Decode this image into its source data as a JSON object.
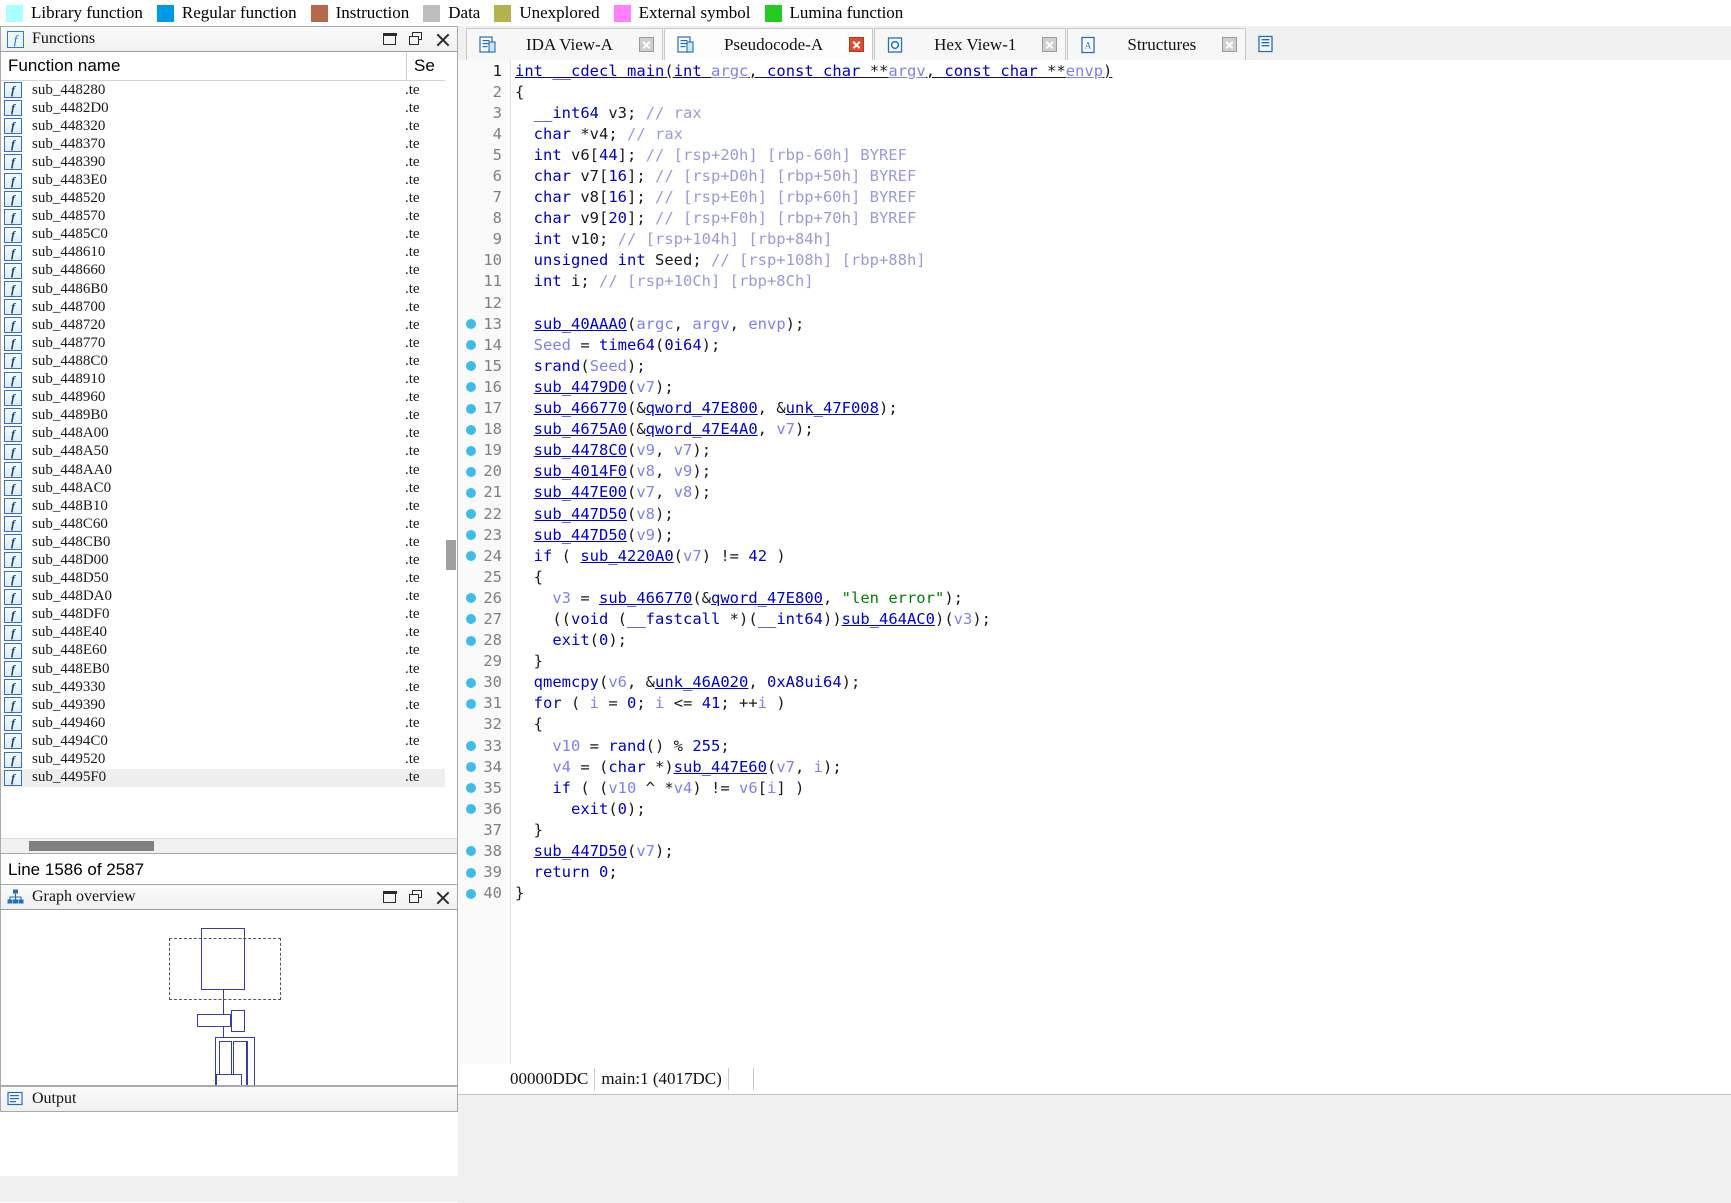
{
  "legend": {
    "items": [
      {
        "label": "Library function",
        "color": "#aaffff"
      },
      {
        "label": "Regular function",
        "color": "#0099e6"
      },
      {
        "label": "Instruction",
        "color": "#b5694a"
      },
      {
        "label": "Data",
        "color": "#bdbdbd"
      },
      {
        "label": "Unexplored",
        "color": "#b3b34d"
      },
      {
        "label": "External symbol",
        "color": "#ff80ff"
      },
      {
        "label": "Lumina function",
        "color": "#22cc22"
      }
    ]
  },
  "functions_panel": {
    "title": "Functions",
    "icon": "function-icon",
    "columns": [
      "Function name",
      "Se"
    ],
    "rows": [
      {
        "name": "sub_448280",
        "segment": ".te"
      },
      {
        "name": "sub_4482D0",
        "segment": ".te"
      },
      {
        "name": "sub_448320",
        "segment": ".te"
      },
      {
        "name": "sub_448370",
        "segment": ".te"
      },
      {
        "name": "sub_448390",
        "segment": ".te"
      },
      {
        "name": "sub_4483E0",
        "segment": ".te"
      },
      {
        "name": "sub_448520",
        "segment": ".te"
      },
      {
        "name": "sub_448570",
        "segment": ".te"
      },
      {
        "name": "sub_4485C0",
        "segment": ".te"
      },
      {
        "name": "sub_448610",
        "segment": ".te"
      },
      {
        "name": "sub_448660",
        "segment": ".te"
      },
      {
        "name": "sub_4486B0",
        "segment": ".te"
      },
      {
        "name": "sub_448700",
        "segment": ".te"
      },
      {
        "name": "sub_448720",
        "segment": ".te"
      },
      {
        "name": "sub_448770",
        "segment": ".te"
      },
      {
        "name": "sub_4488C0",
        "segment": ".te"
      },
      {
        "name": "sub_448910",
        "segment": ".te"
      },
      {
        "name": "sub_448960",
        "segment": ".te"
      },
      {
        "name": "sub_4489B0",
        "segment": ".te"
      },
      {
        "name": "sub_448A00",
        "segment": ".te"
      },
      {
        "name": "sub_448A50",
        "segment": ".te"
      },
      {
        "name": "sub_448AA0",
        "segment": ".te"
      },
      {
        "name": "sub_448AC0",
        "segment": ".te"
      },
      {
        "name": "sub_448B10",
        "segment": ".te"
      },
      {
        "name": "sub_448C60",
        "segment": ".te"
      },
      {
        "name": "sub_448CB0",
        "segment": ".te"
      },
      {
        "name": "sub_448D00",
        "segment": ".te"
      },
      {
        "name": "sub_448D50",
        "segment": ".te"
      },
      {
        "name": "sub_448DA0",
        "segment": ".te"
      },
      {
        "name": "sub_448DF0",
        "segment": ".te"
      },
      {
        "name": "sub_448E40",
        "segment": ".te"
      },
      {
        "name": "sub_448E60",
        "segment": ".te"
      },
      {
        "name": "sub_448EB0",
        "segment": ".te"
      },
      {
        "name": "sub_449330",
        "segment": ".te"
      },
      {
        "name": "sub_449390",
        "segment": ".te"
      },
      {
        "name": "sub_449460",
        "segment": ".te"
      },
      {
        "name": "sub_4494C0",
        "segment": ".te"
      },
      {
        "name": "sub_449520",
        "segment": ".te"
      },
      {
        "name": "sub_4495F0",
        "segment": ".te",
        "selected": true
      }
    ],
    "status": "Line 1586 of 2587"
  },
  "graph_overview": {
    "title": "Graph overview",
    "icon": "graph-icon"
  },
  "output_panel": {
    "title": "Output",
    "icon": "output-icon"
  },
  "tabs": [
    {
      "label": "IDA View-A",
      "icon": "document-icon",
      "active": false,
      "close_style": "grey"
    },
    {
      "label": "Pseudocode-A",
      "icon": "document-icon",
      "active": true,
      "close_style": "red"
    },
    {
      "label": "Hex View-1",
      "icon": "hex-icon",
      "active": false,
      "close_style": "grey"
    },
    {
      "label": "Structures",
      "icon": "structures-icon",
      "active": false,
      "close_style": "grey"
    }
  ],
  "pseudocode": {
    "status_address": "00000DDC",
    "status_location": "main:1  (4017DC)",
    "lines": [
      {
        "n": 1,
        "bp": false,
        "html": "<span class='c-kw c-underline'>int</span><span class='c-plain c-underline'> </span><span class='c-kw c-underline'>__cdecl</span><span class='c-plain c-underline'> </span><span class='c-lib c-underline'>main</span><span class='c-plain c-underline'>(</span><span class='c-kw c-underline'>int</span><span class='c-plain c-underline'> </span><span class='c-var c-underline'>argc</span><span class='c-plain c-underline'>, </span><span class='c-kw c-underline'>const</span><span class='c-plain c-underline'> </span><span class='c-kw c-underline'>char</span><span class='c-plain c-underline'> **</span><span class='c-var c-underline'>argv</span><span class='c-plain c-underline'>, </span><span class='c-kw c-underline'>const</span><span class='c-plain c-underline'> </span><span class='c-kw c-underline'>char</span><span class='c-plain c-underline'> **</span><span class='c-var c-underline'>envp</span><span class='c-plain c-underline'>)</span>"
      },
      {
        "n": 2,
        "bp": false,
        "html": "<span class='c-plain'>{</span>"
      },
      {
        "n": 3,
        "bp": false,
        "html": "<span class='c-plain'>  </span><span class='c-kw'>__int64</span><span class='c-plain'> v3; </span><span class='c-cmt'>// rax</span>"
      },
      {
        "n": 4,
        "bp": false,
        "html": "<span class='c-plain'>  </span><span class='c-kw'>char</span><span class='c-plain'> *v4; </span><span class='c-cmt'>// rax</span>"
      },
      {
        "n": 5,
        "bp": false,
        "html": "<span class='c-plain'>  </span><span class='c-kw'>int</span><span class='c-plain'> v6[</span><span class='c-kw'>44</span><span class='c-plain'>]; </span><span class='c-cmt'>// [rsp+20h] [rbp-60h] BYREF</span>"
      },
      {
        "n": 6,
        "bp": false,
        "html": "<span class='c-plain'>  </span><span class='c-kw'>char</span><span class='c-plain'> v7[</span><span class='c-kw'>16</span><span class='c-plain'>]; </span><span class='c-cmt'>// [rsp+D0h] [rbp+50h] BYREF</span>"
      },
      {
        "n": 7,
        "bp": false,
        "html": "<span class='c-plain'>  </span><span class='c-kw'>char</span><span class='c-plain'> v8[</span><span class='c-kw'>16</span><span class='c-plain'>]; </span><span class='c-cmt'>// [rsp+E0h] [rbp+60h] BYREF</span>"
      },
      {
        "n": 8,
        "bp": false,
        "html": "<span class='c-plain'>  </span><span class='c-kw'>char</span><span class='c-plain'> v9[</span><span class='c-kw'>20</span><span class='c-plain'>]; </span><span class='c-cmt'>// [rsp+F0h] [rbp+70h] BYREF</span>"
      },
      {
        "n": 9,
        "bp": false,
        "html": "<span class='c-plain'>  </span><span class='c-kw'>int</span><span class='c-plain'> v10; </span><span class='c-cmt'>// [rsp+104h] [rbp+84h]</span>"
      },
      {
        "n": 10,
        "bp": false,
        "html": "<span class='c-plain'>  </span><span class='c-kw'>unsigned int</span><span class='c-plain'> Seed; </span><span class='c-cmt'>// [rsp+108h] [rbp+88h]</span>"
      },
      {
        "n": 11,
        "bp": false,
        "html": "<span class='c-plain'>  </span><span class='c-kw'>int</span><span class='c-plain'> i; </span><span class='c-cmt'>// [rsp+10Ch] [rbp+8Ch]</span>"
      },
      {
        "n": 12,
        "bp": false,
        "html": ""
      },
      {
        "n": 13,
        "bp": true,
        "html": "<span class='c-plain'>  </span><span class='c-fn'>sub_40AAA0</span><span class='c-plain'>(</span><span class='c-var'>argc</span><span class='c-plain'>, </span><span class='c-var'>argv</span><span class='c-plain'>, </span><span class='c-var'>envp</span><span class='c-plain'>);</span>"
      },
      {
        "n": 14,
        "bp": true,
        "html": "<span class='c-plain'>  </span><span class='c-var'>Seed</span><span class='c-plain'> = </span><span class='c-lib'>time64</span><span class='c-plain'>(</span><span class='c-kw'>0i64</span><span class='c-plain'>);</span>"
      },
      {
        "n": 15,
        "bp": true,
        "html": "<span class='c-plain'>  </span><span class='c-lib'>srand</span><span class='c-plain'>(</span><span class='c-var'>Seed</span><span class='c-plain'>);</span>"
      },
      {
        "n": 16,
        "bp": true,
        "html": "<span class='c-plain'>  </span><span class='c-fn'>sub_4479D0</span><span class='c-plain'>(</span><span class='c-var'>v7</span><span class='c-plain'>);</span>"
      },
      {
        "n": 17,
        "bp": true,
        "html": "<span class='c-plain'>  </span><span class='c-fn'>sub_466770</span><span class='c-plain'>(&amp;</span><span class='c-fn'>qword_47E800</span><span class='c-plain'>, &amp;</span><span class='c-fn'>unk_47F008</span><span class='c-plain'>);</span>"
      },
      {
        "n": 18,
        "bp": true,
        "html": "<span class='c-plain'>  </span><span class='c-fn'>sub_4675A0</span><span class='c-plain'>(&amp;</span><span class='c-fn'>qword_47E4A0</span><span class='c-plain'>, </span><span class='c-var'>v7</span><span class='c-plain'>);</span>"
      },
      {
        "n": 19,
        "bp": true,
        "html": "<span class='c-plain'>  </span><span class='c-fn'>sub_4478C0</span><span class='c-plain'>(</span><span class='c-var'>v9</span><span class='c-plain'>, </span><span class='c-var'>v7</span><span class='c-plain'>);</span>"
      },
      {
        "n": 20,
        "bp": true,
        "html": "<span class='c-plain'>  </span><span class='c-fn'>sub_4014F0</span><span class='c-plain'>(</span><span class='c-var'>v8</span><span class='c-plain'>, </span><span class='c-var'>v9</span><span class='c-plain'>);</span>"
      },
      {
        "n": 21,
        "bp": true,
        "html": "<span class='c-plain'>  </span><span class='c-fn'>sub_447E00</span><span class='c-plain'>(</span><span class='c-var'>v7</span><span class='c-plain'>, </span><span class='c-var'>v8</span><span class='c-plain'>);</span>"
      },
      {
        "n": 22,
        "bp": true,
        "html": "<span class='c-plain'>  </span><span class='c-fn'>sub_447D50</span><span class='c-plain'>(</span><span class='c-var'>v8</span><span class='c-plain'>);</span>"
      },
      {
        "n": 23,
        "bp": true,
        "html": "<span class='c-plain'>  </span><span class='c-fn'>sub_447D50</span><span class='c-plain'>(</span><span class='c-var'>v9</span><span class='c-plain'>);</span>"
      },
      {
        "n": 24,
        "bp": true,
        "html": "<span class='c-plain'>  </span><span class='c-kw'>if</span><span class='c-plain'> ( </span><span class='c-fn'>sub_4220A0</span><span class='c-plain'>(</span><span class='c-var'>v7</span><span class='c-plain'>) != </span><span class='c-kw'>42</span><span class='c-plain'> )</span>"
      },
      {
        "n": 25,
        "bp": false,
        "html": "<span class='c-plain'>  {</span>"
      },
      {
        "n": 26,
        "bp": true,
        "html": "<span class='c-plain'>    </span><span class='c-var'>v3</span><span class='c-plain'> = </span><span class='c-fn'>sub_466770</span><span class='c-plain'>(&amp;</span><span class='c-fn'>qword_47E800</span><span class='c-plain'>, </span><span class='c-str'>\"len error\"</span><span class='c-plain'>);</span>"
      },
      {
        "n": 27,
        "bp": true,
        "html": "<span class='c-plain'>    ((</span><span class='c-kw'>void</span><span class='c-plain'> (</span><span class='c-kw'>__fastcall</span><span class='c-plain'> *)(</span><span class='c-kw'>__int64</span><span class='c-plain'>))</span><span class='c-fn'>sub_464AC0</span><span class='c-plain'>)(</span><span class='c-var'>v3</span><span class='c-plain'>);</span>"
      },
      {
        "n": 28,
        "bp": true,
        "html": "<span class='c-plain'>    </span><span class='c-lib'>exit</span><span class='c-plain'>(</span><span class='c-kw'>0</span><span class='c-plain'>);</span>"
      },
      {
        "n": 29,
        "bp": false,
        "html": "<span class='c-plain'>  }</span>"
      },
      {
        "n": 30,
        "bp": true,
        "html": "<span class='c-plain'>  </span><span class='c-lib'>qmemcpy</span><span class='c-plain'>(</span><span class='c-var'>v6</span><span class='c-plain'>, &amp;</span><span class='c-fn'>unk_46A020</span><span class='c-plain'>, </span><span class='c-kw'>0xA8ui64</span><span class='c-plain'>);</span>"
      },
      {
        "n": 31,
        "bp": true,
        "html": "<span class='c-plain'>  </span><span class='c-kw'>for</span><span class='c-plain'> ( </span><span class='c-var'>i</span><span class='c-plain'> = </span><span class='c-kw'>0</span><span class='c-plain'>; </span><span class='c-var'>i</span><span class='c-plain'> &lt;= </span><span class='c-kw'>41</span><span class='c-plain'>; ++</span><span class='c-var'>i</span><span class='c-plain'> )</span>"
      },
      {
        "n": 32,
        "bp": false,
        "html": "<span class='c-plain'>  {</span>"
      },
      {
        "n": 33,
        "bp": true,
        "html": "<span class='c-plain'>    </span><span class='c-var'>v10</span><span class='c-plain'> = </span><span class='c-lib'>rand</span><span class='c-plain'>() % </span><span class='c-kw'>255</span><span class='c-plain'>;</span>"
      },
      {
        "n": 34,
        "bp": true,
        "html": "<span class='c-plain'>    </span><span class='c-var'>v4</span><span class='c-plain'> = (</span><span class='c-kw'>char</span><span class='c-plain'> *)</span><span class='c-fn'>sub_447E60</span><span class='c-plain'>(</span><span class='c-var'>v7</span><span class='c-plain'>, </span><span class='c-var'>i</span><span class='c-plain'>);</span>"
      },
      {
        "n": 35,
        "bp": true,
        "html": "<span class='c-plain'>    </span><span class='c-kw'>if</span><span class='c-plain'> ( (</span><span class='c-var'>v10</span><span class='c-plain'> ^ *</span><span class='c-var'>v4</span><span class='c-plain'>) != </span><span class='c-var'>v6</span><span class='c-plain'>[</span><span class='c-var'>i</span><span class='c-plain'>] )</span>"
      },
      {
        "n": 36,
        "bp": true,
        "html": "<span class='c-plain'>      </span><span class='c-lib'>exit</span><span class='c-plain'>(</span><span class='c-kw'>0</span><span class='c-plain'>);</span>"
      },
      {
        "n": 37,
        "bp": false,
        "html": "<span class='c-plain'>  }</span>"
      },
      {
        "n": 38,
        "bp": true,
        "html": "<span class='c-plain'>  </span><span class='c-fn'>sub_447D50</span><span class='c-plain'>(</span><span class='c-var'>v7</span><span class='c-plain'>);</span>"
      },
      {
        "n": 39,
        "bp": true,
        "html": "<span class='c-plain'>  </span><span class='c-kw'>return</span><span class='c-plain'> </span><span class='c-kw'>0</span><span class='c-plain'>;</span>"
      },
      {
        "n": 40,
        "bp": true,
        "html": "<span class='c-plain'>}</span>"
      }
    ]
  }
}
